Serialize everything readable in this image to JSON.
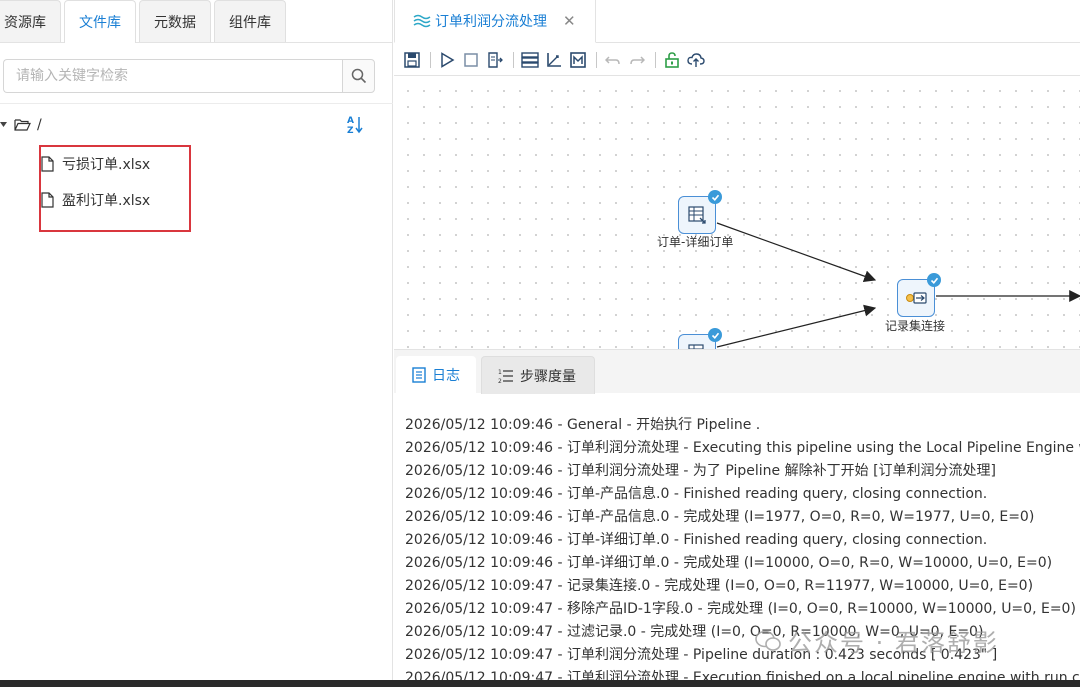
{
  "left_tabs": [
    "资源库",
    "文件库",
    "元数据",
    "组件库"
  ],
  "search": {
    "placeholder": "请输入关键字检索"
  },
  "tree": {
    "root": "/",
    "files": [
      "亏损订单.xlsx",
      "盈利订单.xlsx"
    ]
  },
  "editor": {
    "tab_title": "订单利润分流处理",
    "close_symbol": "✕"
  },
  "canvas": {
    "nodes": {
      "detail_order": "订单-详细订单",
      "record_join": "记录集连接"
    }
  },
  "log_tabs": {
    "log": "日志",
    "metrics": "步骤度量"
  },
  "log_lines": [
    "2026/05/12 10:09:46 - General - 开始执行 Pipeline .",
    "2026/05/12 10:09:46 - 订单利润分流处理 - Executing this pipeline using the Local Pipeline Engine with run configuration 'local'",
    "2026/05/12 10:09:46 - 订单利润分流处理 - 为了 Pipeline 解除补丁开始 [订单利润分流处理]",
    "2026/05/12 10:09:46 - 订单-产品信息.0 - Finished reading query, closing connection.",
    "2026/05/12 10:09:46 - 订单-产品信息.0 - 完成处理 (I=1977, O=0, R=0, W=1977, U=0, E=0)",
    "2026/05/12 10:09:46 - 订单-详细订单.0 - Finished reading query, closing connection.",
    "2026/05/12 10:09:46 - 订单-详细订单.0 - 完成处理 (I=10000, O=0, R=0, W=10000, U=0, E=0)",
    "2026/05/12 10:09:47 - 记录集连接.0 - 完成处理 (I=0, O=0, R=11977, W=10000, U=0, E=0)",
    "2026/05/12 10:09:47 - 移除产品ID-1字段.0 - 完成处理 (I=0, O=0, R=10000, W=10000, U=0, E=0)",
    "2026/05/12 10:09:47 - 过滤记录.0 - 完成处理 (I=0, O=0, R=10000, W=0, U=0, E=0)",
    "2026/05/12 10:09:47 - 订单利润分流处理 - Pipeline duration : 0.423 seconds [  0.423\" ]",
    "2026/05/12 10:09:47 - 订单利润分流处理 - Execution finished on a local pipeline engine with run configuration 'local'"
  ],
  "watermark": "公众号 · 君落舒影"
}
